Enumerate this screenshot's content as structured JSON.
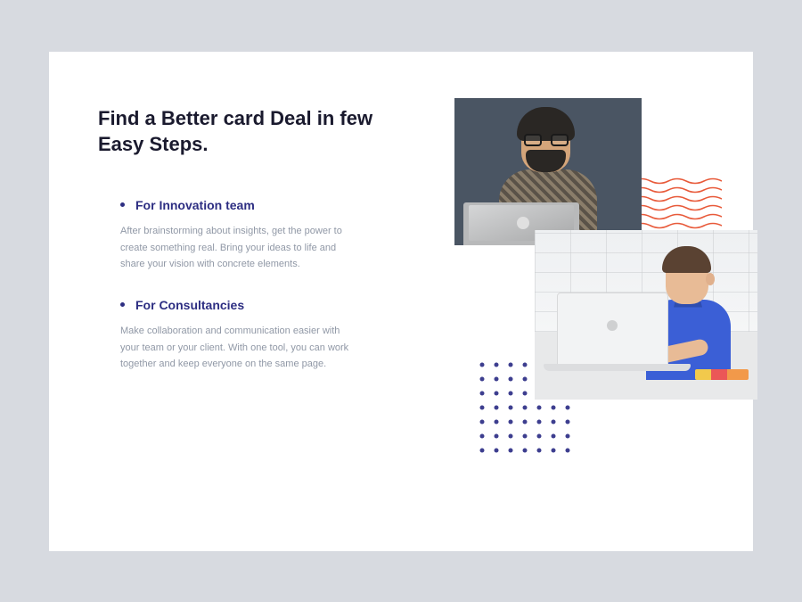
{
  "heading": "Find a Better card Deal in few Easy Steps.",
  "features": [
    {
      "title": "For Innovation team",
      "body": "After brainstorming about insights, get the power to create something real. Bring your ideas to life and share your vision with concrete elements."
    },
    {
      "title": "For Consultancies",
      "body": "Make collaboration and communication easier with your team or your client. With one tool, you can work together and keep everyone on the same page."
    }
  ],
  "colors": {
    "accent": "#2d2e82",
    "wave": "#e85a3a",
    "dot": "#3d3e8f"
  },
  "images": {
    "img1_alt": "Man with glasses and beard using a laptop",
    "img2_alt": "Young person in blue polo typing on a white laptop"
  }
}
